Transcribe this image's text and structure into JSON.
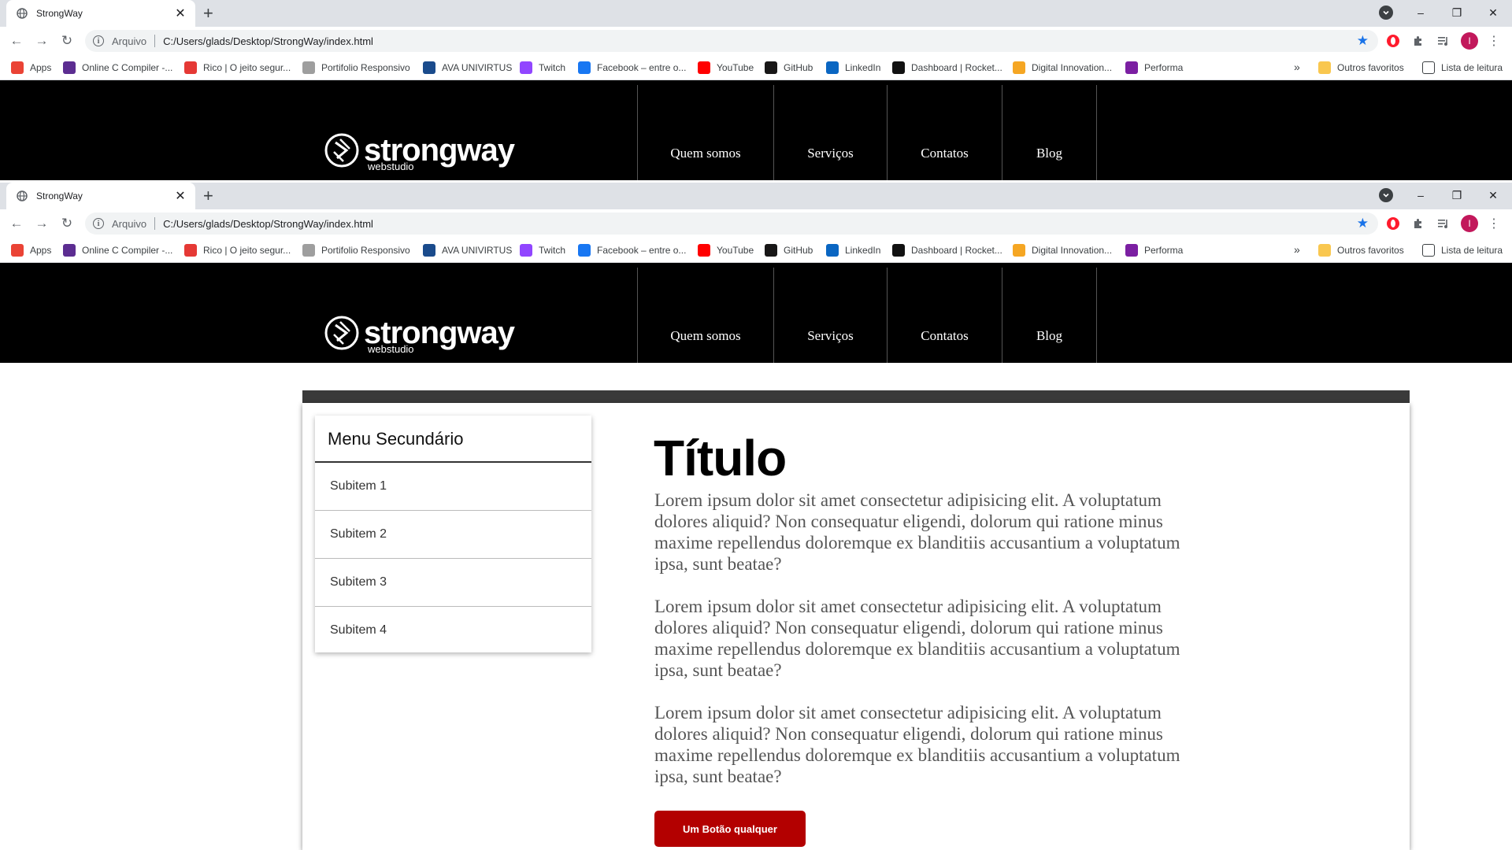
{
  "browser": {
    "tab_title": "StrongWay",
    "new_tab": "+",
    "window_controls": [
      "–",
      "❐",
      "✕"
    ],
    "protocol_label": "Arquivo",
    "url": "C:/Users/glads/Desktop/StrongWay/index.html",
    "profile_initial": "I",
    "bookmarks": [
      {
        "label": "Apps",
        "icon": "apps-grid-icon",
        "color": "#ea4335"
      },
      {
        "label": "Online C Compiler -...",
        "icon": "bolt-icon",
        "color": "#5c2d91"
      },
      {
        "label": "Rico | O jeito segur...",
        "icon": "rico-icon",
        "color": "#e53935"
      },
      {
        "label": "Portifolio Responsivo",
        "icon": "gf-icon",
        "color": "#9e9e9e"
      },
      {
        "label": "AVA UNIVIRTUS",
        "icon": "uninter-icon",
        "color": "#1a4b8c"
      },
      {
        "label": "Twitch",
        "icon": "twitch-icon",
        "color": "#9146ff"
      },
      {
        "label": "Facebook – entre o...",
        "icon": "facebook-icon",
        "color": "#1877f2"
      },
      {
        "label": "YouTube",
        "icon": "youtube-icon",
        "color": "#ff0000"
      },
      {
        "label": "GitHub",
        "icon": "github-icon",
        "color": "#181717"
      },
      {
        "label": "LinkedIn",
        "icon": "linkedin-icon",
        "color": "#0a66c2"
      },
      {
        "label": "Dashboard | Rocket...",
        "icon": "rocketseat-icon",
        "color": "#111111"
      },
      {
        "label": "Digital Innovation...",
        "icon": "dio-icon",
        "color": "#f5a623"
      },
      {
        "label": "Performa",
        "icon": "performa-icon",
        "color": "#7b1fa2"
      }
    ],
    "more_bookmarks": "»",
    "other_favorites": "Outros favoritos",
    "reading_list": "Lista de leitura"
  },
  "site": {
    "brand": "strongway",
    "brand_sub": "webstudio",
    "nav": [
      "Quem somos",
      "Serviços",
      "Contatos",
      "Blog"
    ]
  },
  "sidebar": {
    "title": "Menu Secundário",
    "items": [
      "Subitem 1",
      "Subitem 2",
      "Subitem 3",
      "Subitem 4"
    ]
  },
  "main": {
    "title": "Título",
    "paragraphs": [
      "Lorem ipsum dolor sit amet consectetur adipisicing elit. A voluptatum dolores aliquid? Non consequatur eligendi, dolorum qui ratione minus maxime repellendus doloremque ex blanditiis accusantium a voluptatum ipsa, sunt beatae?",
      "Lorem ipsum dolor sit amet consectetur adipisicing elit. A voluptatum dolores aliquid? Non consequatur eligendi, dolorum qui ratione minus maxime repellendus doloremque ex blanditiis accusantium a voluptatum ipsa, sunt beatae?",
      "Lorem ipsum dolor sit amet consectetur adipisicing elit. A voluptatum dolores aliquid? Non consequatur eligendi, dolorum qui ratione minus maxime repellendus doloremque ex blanditiis accusantium a voluptatum ipsa, sunt beatae?"
    ],
    "button": "Um Botão qualquer"
  },
  "colors": {
    "header_bg": "#000000",
    "button_bg": "#b30000",
    "content_bar": "#3a3a3a"
  }
}
